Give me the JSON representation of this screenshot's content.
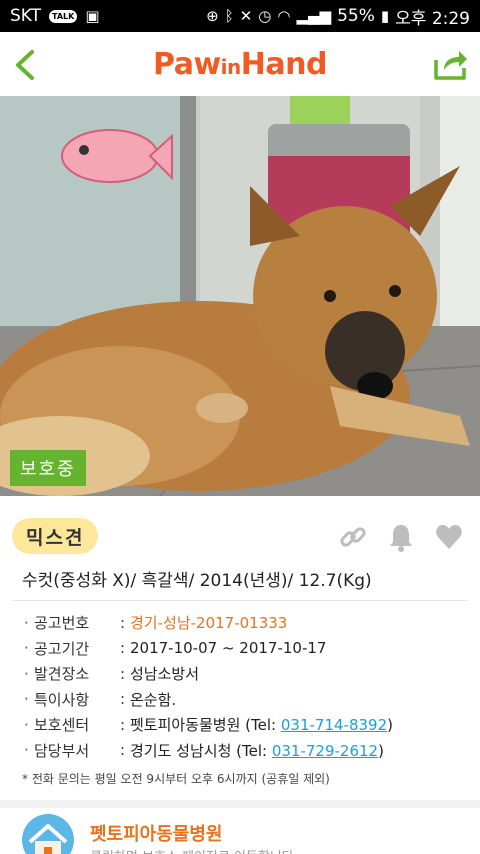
{
  "status_bar": {
    "carrier": "SKT",
    "talk_badge": "TALK",
    "battery": "55%",
    "time": "오후 2:29"
  },
  "app": {
    "logo_main": "Paw",
    "logo_in": "in",
    "logo_end": "Hand",
    "accent_color": "#f15a22",
    "nav_color": "#65b32e"
  },
  "photo": {
    "status_badge": "보호중"
  },
  "animal": {
    "breed": "믹스견",
    "summary": "수컷(중성화 X)/ 흑갈색/ 2014(년생)/ 12.7(Kg)"
  },
  "details": [
    {
      "label": "공고번호",
      "value": "경기-성남-2017-01333",
      "kind": "orange"
    },
    {
      "label": "공고기간",
      "value": "2017-10-07 ~ 2017-10-17",
      "kind": "plain"
    },
    {
      "label": "발견장소",
      "value": "성남소방서",
      "kind": "plain"
    },
    {
      "label": "특이사항",
      "value": "온순함.",
      "kind": "plain"
    },
    {
      "label": "보호센터",
      "value": "펫토피아동물병원 (Tel: ",
      "tel": "031-714-8392",
      "suffix": ")",
      "kind": "tel"
    },
    {
      "label": "담당부서",
      "value": "경기도 성남시청 (Tel: ",
      "tel": "031-729-2612",
      "suffix": ")",
      "kind": "tel"
    }
  ],
  "note": "* 전화 문의는 평일 오전 9시부터 오후 6시까지 (공휴일 제외)",
  "shelter": {
    "name": "펫토피아동물병원",
    "hint": "클릭하면 보호소 페이지로 이동합니다"
  }
}
